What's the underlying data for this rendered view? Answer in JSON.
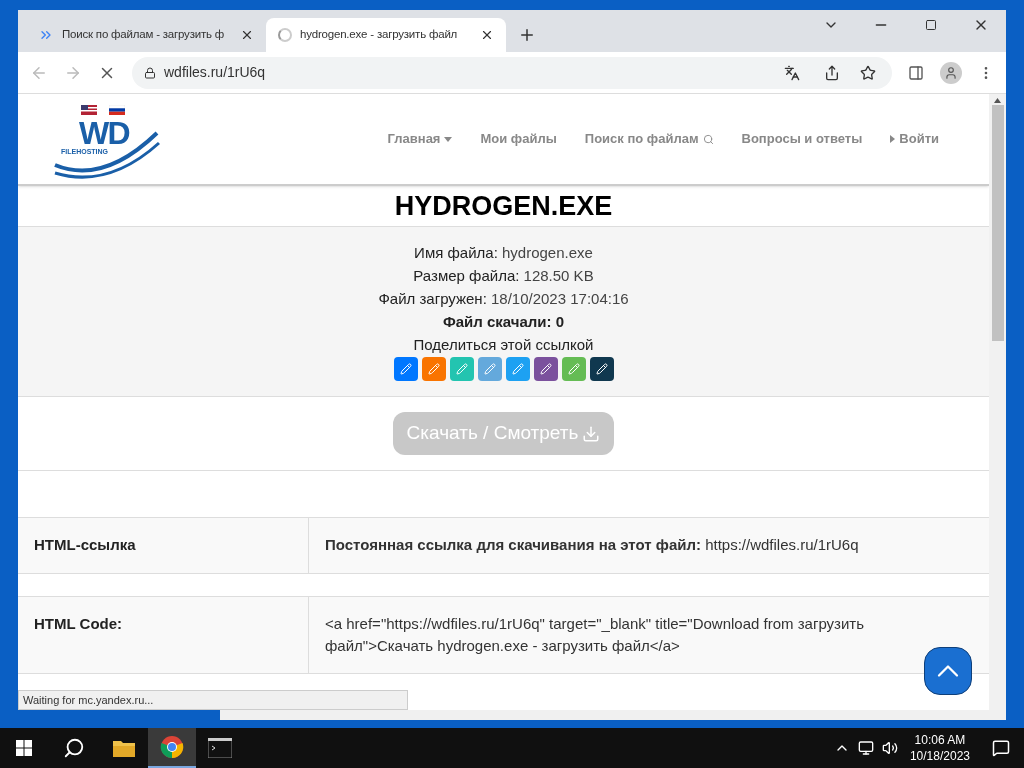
{
  "browser": {
    "tabs": [
      {
        "title": "Поиск по файлам - загрузить ф",
        "selected": false,
        "loading": false
      },
      {
        "title": "hydrogen.exe - загрузить файл",
        "selected": true,
        "loading": true
      }
    ],
    "address": "wdfiles.ru/1rU6q",
    "status": "Waiting for mc.yandex.ru..."
  },
  "site": {
    "logo": {
      "mark": "WD",
      "tagline": "FILEHOSTING"
    },
    "nav": [
      {
        "label": "Главная",
        "kind": "dropdown"
      },
      {
        "label": "Мои файлы",
        "kind": "plain"
      },
      {
        "label": "Поиск по файлам",
        "kind": "search"
      },
      {
        "label": "Вопросы и ответы",
        "kind": "plain"
      },
      {
        "label": "Войти",
        "kind": "login"
      }
    ],
    "title": "HYDROGEN.EXE",
    "info": [
      {
        "kind": "pair",
        "label": "Имя файла:",
        "value": "hydrogen.exe"
      },
      {
        "kind": "pair",
        "label": "Размер файла:",
        "value": "128.50 KB"
      },
      {
        "kind": "pair",
        "label": "Файл загружен:",
        "value": "18/10/2023 17:04:16"
      },
      {
        "kind": "bold",
        "label": "Файл скачали: 0"
      },
      {
        "kind": "plain",
        "label": "Поделиться этой ссылкой"
      }
    ],
    "share": [
      {
        "color": "#0077ff"
      },
      {
        "color": "#f97400"
      },
      {
        "color": "#23c4b0"
      },
      {
        "color": "#64a9dc"
      },
      {
        "color": "#1da1f2"
      },
      {
        "color": "#7b519d"
      },
      {
        "color": "#65bc54"
      },
      {
        "color": "#10384f"
      }
    ],
    "download": {
      "label": "Скачать / Смотреть",
      "disabled": true
    },
    "rows": [
      {
        "label": "HTML-ссылка",
        "content": "**Постоянная ссылка для скачивания на этот файл:** https://wdfiles.ru/1rU6q"
      },
      {
        "label": "HTML Code:",
        "content": "<a href=\"https://wdfiles.ru/1rU6q\" target=\"_blank\" title=\"Download from загрузить файл\">Скачать hydrogen.exe - загрузить файл</a>"
      }
    ]
  },
  "taskbar": {
    "apps": [
      {
        "kind": "folder",
        "selected": false
      },
      {
        "kind": "chrome",
        "selected": true
      },
      {
        "kind": "terminal",
        "selected": false
      }
    ],
    "time": "10:06 AM",
    "date": "10/18/2023"
  }
}
